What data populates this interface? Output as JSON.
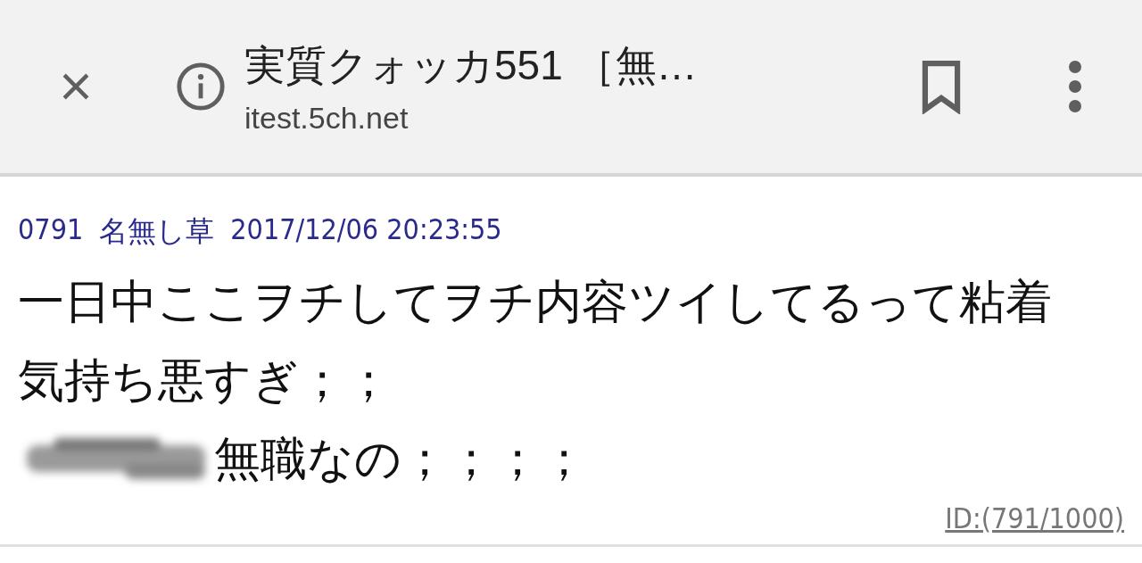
{
  "toolbar": {
    "title": "実質クォッカ551 ［無…",
    "url": "itest.5ch.net"
  },
  "post": {
    "number": "0791",
    "name": "名無し草",
    "datetime": "2017/12/06 20:23:55",
    "lines": [
      {
        "kind": "text",
        "text": "一日中ここヲチしてヲチ内容ツイしてるって粘着気持ち悪すぎ；；"
      },
      {
        "kind": "redacted",
        "text": "無職なの；；；；"
      }
    ],
    "id_link": "ID:(791/1000)"
  }
}
